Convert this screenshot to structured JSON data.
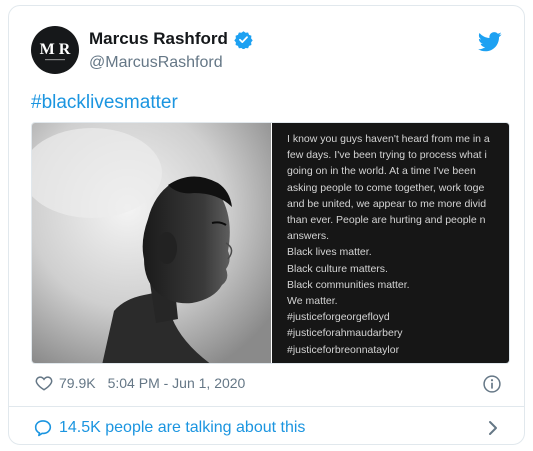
{
  "author": {
    "name": "Marcus Rashford",
    "handle": "@MarcusRashford",
    "avatar_letters": "M R"
  },
  "tweet": {
    "text": "#blacklivesmatter",
    "statement_lines": [
      "I know you guys haven't heard from me in a",
      "few days. I've been trying to process what i",
      "going on in the world. At a time I've been",
      "asking people to come together, work toge",
      "and be united, we appear to me more divid",
      "than ever. People are hurting and people n",
      "answers.",
      "Black lives matter.",
      "Black culture matters.",
      "Black communities matter.",
      "We matter.",
      "#justiceforgeorgefloyd",
      "#justiceforahmaudarbery",
      "#justiceforbreonnataylor"
    ]
  },
  "meta": {
    "likes": "79.9K",
    "time": "5:04 PM - Jun 1, 2020"
  },
  "footer": {
    "talking_label": "14.5K people are talking about this"
  },
  "colors": {
    "link": "#1b95e0",
    "muted": "#657786",
    "verified": "#1da1f2",
    "panel": "#161616"
  },
  "icons": [
    "verified-badge-icon",
    "twitter-bird-icon",
    "heart-icon",
    "info-icon",
    "comment-icon",
    "chevron-right-icon"
  ]
}
